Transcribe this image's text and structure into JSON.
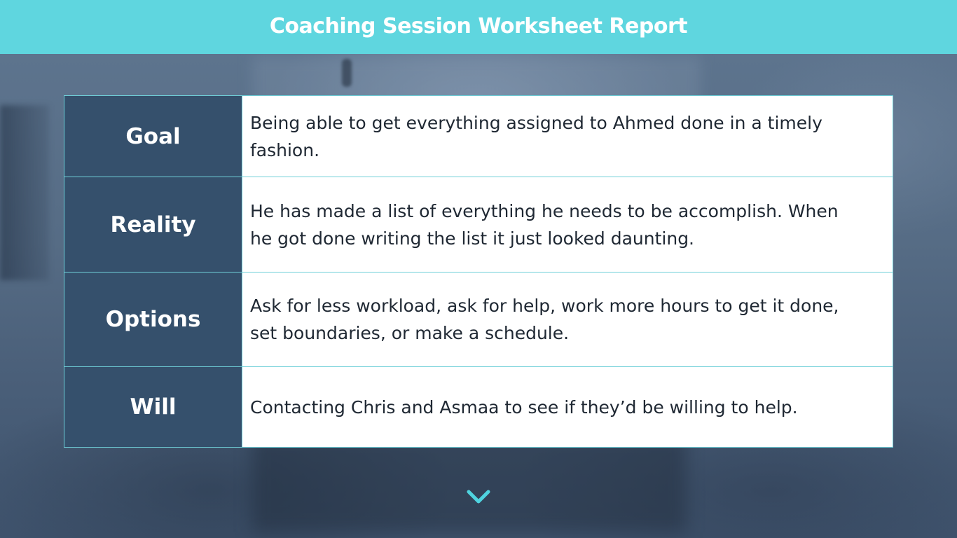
{
  "header": {
    "title": "Coaching Session Worksheet Report"
  },
  "worksheet": {
    "rows": [
      {
        "label": "Goal",
        "value": "Being able to get everything assigned to Ahmed done in a timely fashion."
      },
      {
        "label": "Reality",
        "value": "He has made a list of everything he needs to be accomplish. When he got done writing the list it just looked daunting."
      },
      {
        "label": "Options",
        "value": "Ask for less workload, ask for help, work more hours to get it done, set boundaries, or make a schedule."
      },
      {
        "label": "Will",
        "value": "Contacting Chris and Asmaa to see if they’d be willing to help."
      }
    ]
  },
  "icons": {
    "scroll_down": "chevron-down-icon"
  },
  "colors": {
    "header_bg": "#5fd6df",
    "label_bg": "#35506c",
    "border": "#6fcfd8",
    "accent": "#4fd3df"
  }
}
